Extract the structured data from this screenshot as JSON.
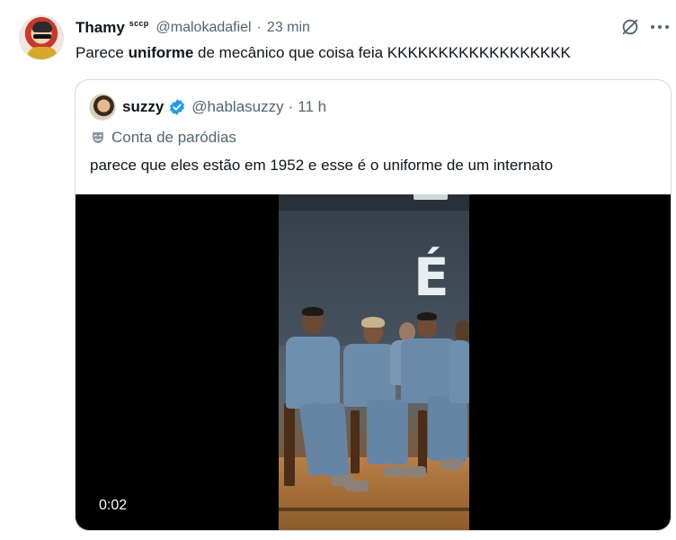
{
  "tweet": {
    "display_name": "Thamy",
    "name_tag": "sccp",
    "handle": "@malokadafiel",
    "separator": "·",
    "time": "23 min",
    "text_before": "Parece ",
    "text_bold": "uniforme",
    "text_after": " de mecânico que coisa feia KKKKKKKKKKKKKKKKKK",
    "icons": [
      "grok-icon",
      "more-icon"
    ]
  },
  "quote": {
    "display_name": "suzzy",
    "verified": true,
    "handle": "@hablasuzzy",
    "separator": "·",
    "time": "11 h",
    "parody_label": "Conta de paródias",
    "text": "parece que eles estão em 1952 e esse é o uniforme de um internato",
    "video": {
      "timestamp": "0:02"
    }
  },
  "colors": {
    "text_primary": "#0f1419",
    "text_secondary": "#536471",
    "border": "#cfd9de",
    "verified_blue": "#1d9bf0"
  }
}
